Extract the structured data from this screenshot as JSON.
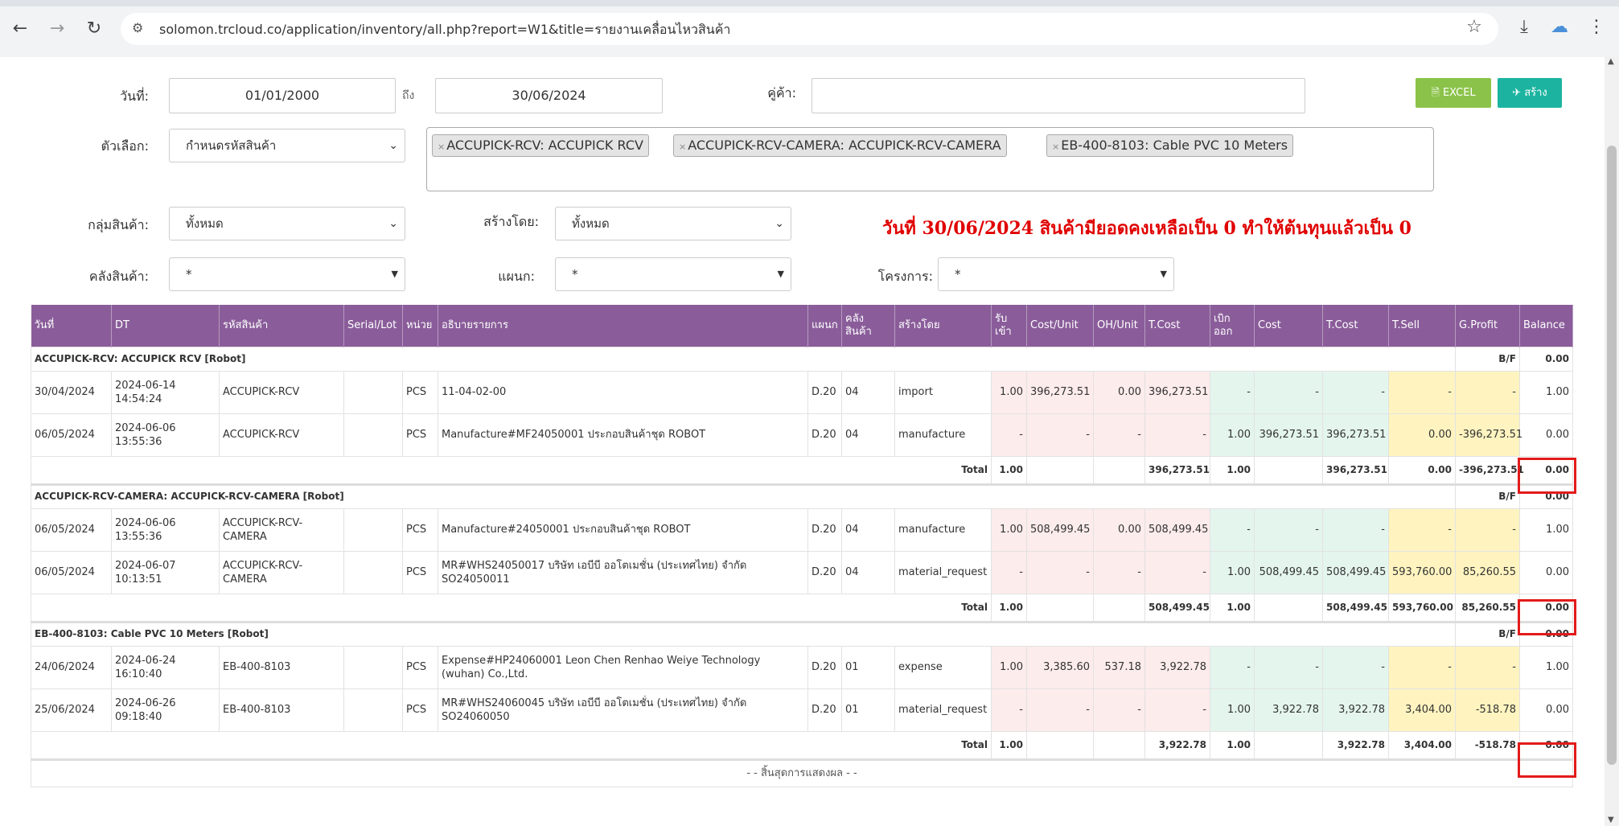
{
  "browser": {
    "url": "solomon.trcloud.co/application/inventory/all.php?report=W1&title=รายงานเคลื่อนไหวสินค้า"
  },
  "filters": {
    "date_label": "วันที่:",
    "date_from": "01/01/2000",
    "to_label": "ถึง",
    "date_to": "30/06/2024",
    "partner_label": "คู่ค้า:",
    "partner_value": "",
    "option_label": "ตัวเลือก:",
    "option_value": "กำหนดรหัสสินค้า",
    "tags": [
      "ACCUPICK-RCV: ACCUPICK RCV",
      "ACCUPICK-RCV-CAMERA: ACCUPICK-RCV-CAMERA",
      "EB-400-8103: Cable PVC 10 Meters"
    ],
    "group_label": "กลุ่มสินค้า:",
    "group_value": "ทั้งหมด",
    "created_by_label": "สร้างโดย:",
    "created_by_value": "ทั้งหมด",
    "warehouse_label": "คลังสินค้า:",
    "warehouse_value": "*",
    "dept_label": "แผนก:",
    "dept_value": "*",
    "project_label": "โครงการ:",
    "project_value": "*",
    "excel_label": "EXCEL",
    "create_label": "สร้าง"
  },
  "note": "วันที่ 30/06/2024 สินค้ามียอดคงเหลือเป็น 0 ทำให้ต้นทุนแล้วเป็น 0",
  "table": {
    "headers": [
      "วันที่",
      "DT",
      "รหัสสินค้า",
      "Serial/Lot",
      "หน่วย",
      "อธิบายรายการ",
      "แผนก",
      "คลัง สินค้า",
      "สร้างโดย",
      "รับ เข้า",
      "Cost/Unit",
      "OH/Unit",
      "T.Cost",
      "เบิก ออก",
      "Cost",
      "T.Cost",
      "T.Sell",
      "G.Profit",
      "Balance"
    ],
    "groups": [
      {
        "title": "ACCUPICK-RCV: ACCUPICK RCV [Robot]",
        "bf_label": "B/F",
        "bf_value": "0.00",
        "rows": [
          [
            "30/04/2024",
            "2024-06-14 14:54:24",
            "ACCUPICK-RCV",
            "",
            "PCS",
            "11-04-02-00",
            "D.20",
            "04",
            "import",
            "1.00",
            "396,273.51",
            "0.00",
            "396,273.51",
            "-",
            "-",
            "-",
            "-",
            "-",
            "1.00"
          ],
          [
            "06/05/2024",
            "2024-06-06 13:55:36",
            "ACCUPICK-RCV",
            "",
            "PCS",
            "Manufacture#MF24050001 ประกอบสินค้าชุด ROBOT",
            "D.20",
            "04",
            "manufacture",
            "-",
            "-",
            "-",
            "-",
            "1.00",
            "396,273.51",
            "396,273.51",
            "0.00",
            "-396,273.51",
            "0.00"
          ]
        ],
        "total": {
          "label": "Total",
          "in": "1.00",
          "tcost": "396,273.51",
          "out": "1.00",
          "tcost2": "396,273.51",
          "tsell": "0.00",
          "gprofit": "-396,273.51",
          "balance": "0.00"
        }
      },
      {
        "title": "ACCUPICK-RCV-CAMERA: ACCUPICK-RCV-CAMERA [Robot]",
        "bf_label": "B/F",
        "bf_value": "0.00",
        "rows": [
          [
            "06/05/2024",
            "2024-06-06 13:55:36",
            "ACCUPICK-RCV-CAMERA",
            "",
            "PCS",
            "Manufacture#24050001 ประกอบสินค้าชุด ROBOT",
            "D.20",
            "04",
            "manufacture",
            "1.00",
            "508,499.45",
            "0.00",
            "508,499.45",
            "-",
            "-",
            "-",
            "-",
            "-",
            "1.00"
          ],
          [
            "06/05/2024",
            "2024-06-07 10:13:51",
            "ACCUPICK-RCV-CAMERA",
            "",
            "PCS",
            "MR#WHS24050017 บริษัท เอบีบี ออโตเมชั่น (ประเทศไทย) จำกัด SO24050011",
            "D.20",
            "04",
            "material_request",
            "-",
            "-",
            "-",
            "-",
            "1.00",
            "508,499.45",
            "508,499.45",
            "593,760.00",
            "85,260.55",
            "0.00"
          ]
        ],
        "total": {
          "label": "Total",
          "in": "1.00",
          "tcost": "508,499.45",
          "out": "1.00",
          "tcost2": "508,499.45",
          "tsell": "593,760.00",
          "gprofit": "85,260.55",
          "balance": "0.00"
        }
      },
      {
        "title": "EB-400-8103: Cable PVC 10 Meters [Robot]",
        "bf_label": "B/F",
        "bf_value": "0.00",
        "rows": [
          [
            "24/06/2024",
            "2024-06-24 16:10:40",
            "EB-400-8103",
            "",
            "PCS",
            "Expense#HP24060001 Leon Chen Renhao Weiye Technology (wuhan) Co.,Ltd.",
            "D.20",
            "01",
            "expense",
            "1.00",
            "3,385.60",
            "537.18",
            "3,922.78",
            "-",
            "-",
            "-",
            "-",
            "-",
            "1.00"
          ],
          [
            "25/06/2024",
            "2024-06-26 09:18:40",
            "EB-400-8103",
            "",
            "PCS",
            "MR#WHS24060045 บริษัท เอบีบี ออโตเมชั่น (ประเทศไทย) จำกัด SO24060050",
            "D.20",
            "01",
            "material_request",
            "-",
            "-",
            "-",
            "-",
            "1.00",
            "3,922.78",
            "3,922.78",
            "3,404.00",
            "-518.78",
            "0.00"
          ]
        ],
        "total": {
          "label": "Total",
          "in": "1.00",
          "tcost": "3,922.78",
          "out": "1.00",
          "tcost2": "3,922.78",
          "tsell": "3,404.00",
          "gprofit": "-518.78",
          "balance": "0.00"
        }
      }
    ],
    "end_text": "- - สิ้นสุดการแสดงผล - -"
  }
}
